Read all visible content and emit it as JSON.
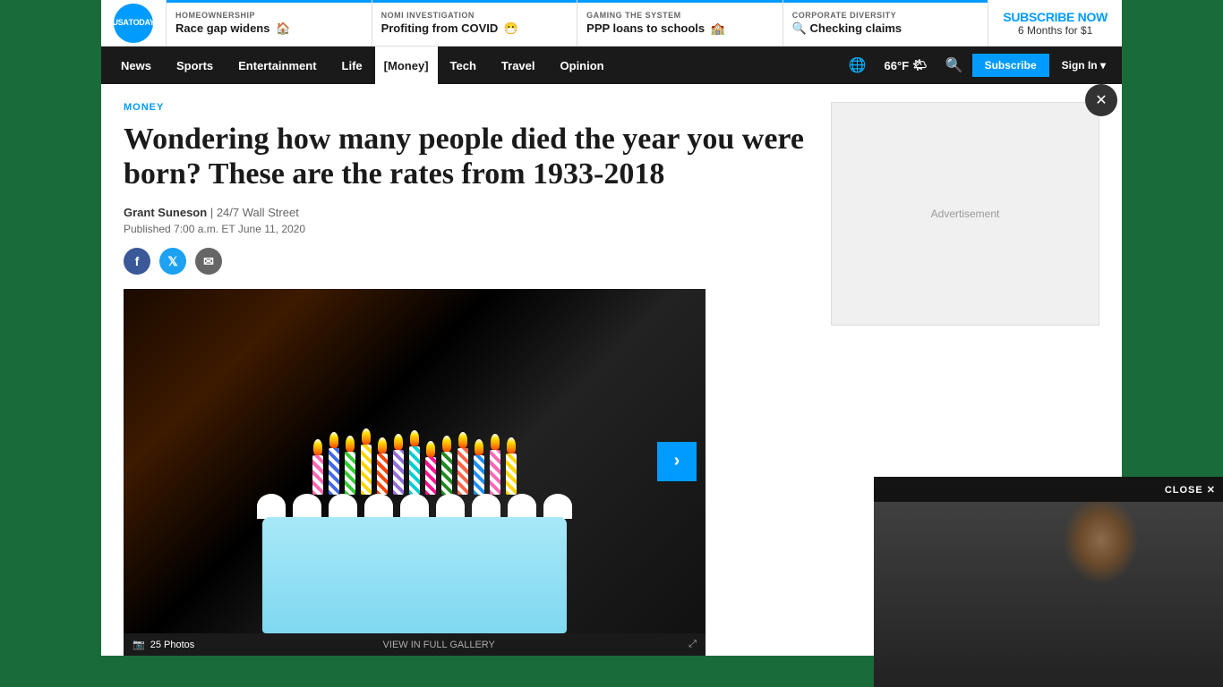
{
  "promo": {
    "logo_line1": "USA",
    "logo_line2": "TODAY",
    "items": [
      {
        "tag": "HOMEOWNERSHIP",
        "text": "Race gap widens",
        "emoji": "🏠",
        "accent_color": "#009bff"
      },
      {
        "tag": "NOMI INVESTIGATION",
        "text": "Profiting from COVID",
        "emoji": "😷",
        "accent_color": "#009bff"
      },
      {
        "tag": "GAMING THE SYSTEM",
        "text": "PPP loans to schools",
        "emoji": "🏫",
        "accent_color": "#009bff"
      },
      {
        "tag": "CORPORATE DIVERSITY",
        "text": "Checking claims",
        "emoji": "🔍",
        "accent_color": "#009bff"
      }
    ],
    "subscribe_title": "SUBSCRIBE NOW",
    "subscribe_sub": "6 Months for $1"
  },
  "nav": {
    "items": [
      "News",
      "Sports",
      "Entertainment",
      "Life",
      "Money",
      "Tech",
      "Travel",
      "Opinion"
    ],
    "active_item": "Money",
    "weather_temp": "66°F",
    "weather_emoji": "🌤",
    "subscribe_label": "Subscribe",
    "signin_label": "Sign In"
  },
  "article": {
    "section_label": "MONEY",
    "title": "Wondering how many people died the year you were born? These are the rates from 1933-2018",
    "author": "Grant Suneson",
    "source": "24/7 Wall Street",
    "published": "Published 7:00 a.m. ET June 11, 2020",
    "image_alt": "Birthday cake with many candles",
    "photo_count": "25 Photos",
    "view_gallery_label": "VIEW IN FULL GALLERY",
    "expand_icon": "⤢"
  },
  "video": {
    "close_label": "CLOSE ✕"
  },
  "social": {
    "facebook_label": "f",
    "twitter_label": "t",
    "email_label": "✉"
  }
}
